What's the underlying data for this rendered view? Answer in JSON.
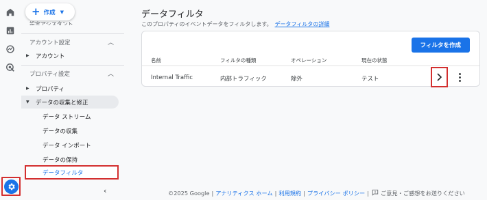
{
  "sidebar": {
    "create_label": "作成",
    "cut_label": "設定アシスタント",
    "account_section": "アカウント設定",
    "account_item": "アカウント",
    "property_section": "プロパティ設定",
    "property_item": "プロパティ",
    "data_item": "データの収集と修正",
    "sub_items": [
      "データ ストリーム",
      "データの収集",
      "データ インポート",
      "データの保持"
    ],
    "active_item": "データフィルタ"
  },
  "main": {
    "title": "データフィルタ",
    "subtitle": "このプロパティのイベントデータをフィルタします。",
    "subtitle_link": "データフィルタの詳細",
    "create_button": "フィルタを作成",
    "columns": [
      "名前",
      "フィルタの種類",
      "オペレーション",
      "現在の状態"
    ],
    "rows": [
      {
        "name": "Internal Traffic",
        "type": "内部トラフィック",
        "operation": "除外",
        "state": "テスト"
      }
    ]
  },
  "footer": {
    "copyright": "©2025 Google",
    "links": [
      "アナリティクス ホーム",
      "利用規約",
      "プライバシー ポリシー"
    ],
    "feedback": "ご意見・ご感想をお送りください"
  },
  "colors": {
    "accent": "#1a73e8",
    "highlight": "#d32f2f"
  }
}
